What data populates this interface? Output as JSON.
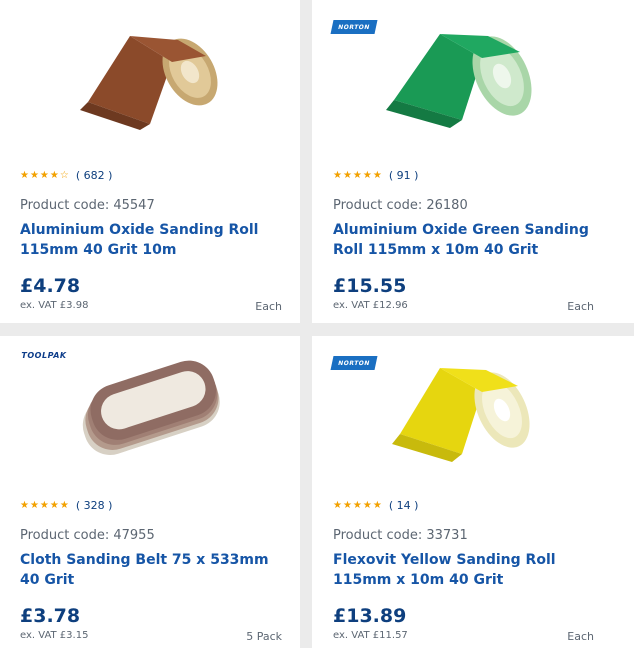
{
  "products": [
    {
      "brand": "",
      "rating_text": "★★★★☆",
      "review_count": "( 682 )",
      "code": "Product code: 45547",
      "title": "Aluminium Oxide Sanding Roll 115mm 40 Grit 10m",
      "price": "£4.78",
      "ex_vat": "ex. VAT £3.98",
      "unit": "Each",
      "image": "brown-sanding-roll"
    },
    {
      "brand": "NORTON",
      "rating_text": "★★★★★",
      "review_count": "( 91 )",
      "code": "Product code: 26180",
      "title": "Aluminium Oxide Green Sanding Roll 115mm x 10m 40 Grit",
      "price": "£15.55",
      "ex_vat": "ex. VAT £12.96",
      "unit": "Each",
      "image": "green-sanding-roll"
    },
    {
      "brand": "TOOLPAK",
      "rating_text": "★★★★★",
      "review_count": "( 328 )",
      "code": "Product code: 47955",
      "title": "Cloth Sanding Belt 75 x 533mm 40 Grit",
      "price": "£3.78",
      "ex_vat": "ex. VAT £3.15",
      "unit": "5 Pack",
      "image": "sanding-belts"
    },
    {
      "brand": "NORTON",
      "rating_text": "★★★★★",
      "review_count": "( 14 )",
      "code": "Product code: 33731",
      "title": "Flexovit Yellow Sanding Roll 115mm x 10m 40 Grit",
      "price": "£13.89",
      "ex_vat": "ex. VAT £11.57",
      "unit": "Each",
      "image": "yellow-sanding-roll"
    }
  ],
  "colors": {
    "title": "#1655a6",
    "price": "#0e3f7e",
    "star": "#f2a100",
    "norton": "#1a6fc2"
  }
}
